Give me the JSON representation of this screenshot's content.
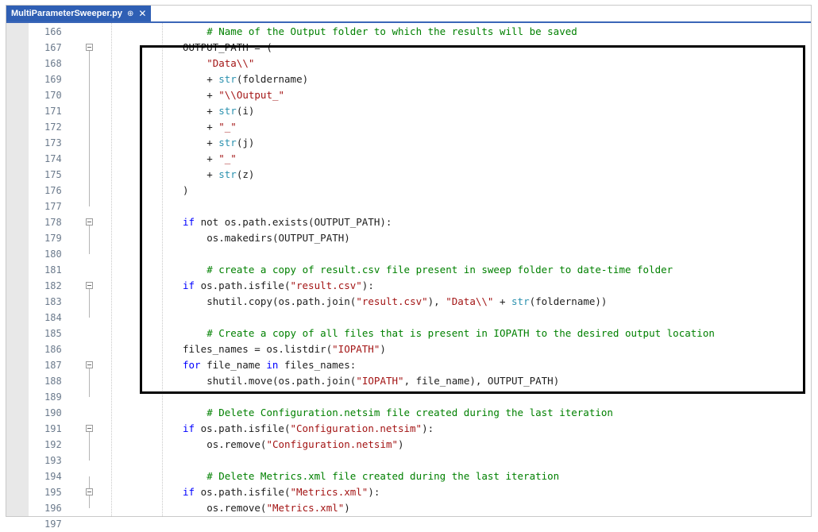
{
  "tab": {
    "title": "MultiParameterSweeper.py",
    "pin_glyph": "⊕",
    "close_glyph": "✕"
  },
  "colors": {
    "keyword": "#0000ff",
    "string": "#a31515",
    "comment": "#008000",
    "builtin": "#2b91af",
    "tab": "#2f5fb4"
  },
  "lines": [
    {
      "n": "166",
      "indent": 8,
      "fold": false,
      "parts": [
        [
          "cm",
          "# Name of the Output folder to which the results will be saved"
        ]
      ]
    },
    {
      "n": "167",
      "indent": 4,
      "fold": true,
      "parts": [
        [
          "t",
          "OUTPUT_PATH = ("
        ]
      ]
    },
    {
      "n": "168",
      "indent": 8,
      "fold": false,
      "parts": [
        [
          "str",
          "\"Data\\\\\""
        ]
      ]
    },
    {
      "n": "169",
      "indent": 8,
      "fold": false,
      "parts": [
        [
          "t",
          "+ "
        ],
        [
          "bi",
          "str"
        ],
        [
          "t",
          "(foldername)"
        ]
      ]
    },
    {
      "n": "170",
      "indent": 8,
      "fold": false,
      "parts": [
        [
          "t",
          "+ "
        ],
        [
          "str",
          "\"\\\\Output_\""
        ]
      ]
    },
    {
      "n": "171",
      "indent": 8,
      "fold": false,
      "parts": [
        [
          "t",
          "+ "
        ],
        [
          "bi",
          "str"
        ],
        [
          "t",
          "(i)"
        ]
      ]
    },
    {
      "n": "172",
      "indent": 8,
      "fold": false,
      "parts": [
        [
          "t",
          "+ "
        ],
        [
          "str",
          "\"_\""
        ]
      ]
    },
    {
      "n": "173",
      "indent": 8,
      "fold": false,
      "parts": [
        [
          "t",
          "+ "
        ],
        [
          "bi",
          "str"
        ],
        [
          "t",
          "(j)"
        ]
      ]
    },
    {
      "n": "174",
      "indent": 8,
      "fold": false,
      "parts": [
        [
          "t",
          "+ "
        ],
        [
          "str",
          "\"_\""
        ]
      ]
    },
    {
      "n": "175",
      "indent": 8,
      "fold": false,
      "parts": [
        [
          "t",
          "+ "
        ],
        [
          "bi",
          "str"
        ],
        [
          "t",
          "(z)"
        ]
      ]
    },
    {
      "n": "176",
      "indent": 4,
      "fold": false,
      "parts": [
        [
          "t",
          ")"
        ]
      ]
    },
    {
      "n": "177",
      "indent": 4,
      "fold": false,
      "parts": []
    },
    {
      "n": "178",
      "indent": 4,
      "fold": true,
      "parts": [
        [
          "kw",
          "if"
        ],
        [
          "t",
          " not os.path.exists(OUTPUT_PATH):"
        ]
      ]
    },
    {
      "n": "179",
      "indent": 8,
      "fold": false,
      "parts": [
        [
          "t",
          "os.makedirs(OUTPUT_PATH)"
        ]
      ]
    },
    {
      "n": "180",
      "indent": 4,
      "fold": false,
      "parts": []
    },
    {
      "n": "181",
      "indent": 8,
      "fold": false,
      "parts": [
        [
          "cm",
          "# create a copy of result.csv file present in sweep folder to date-time folder"
        ]
      ]
    },
    {
      "n": "182",
      "indent": 4,
      "fold": true,
      "parts": [
        [
          "kw",
          "if"
        ],
        [
          "t",
          " os.path.isfile("
        ],
        [
          "str",
          "\"result.csv\""
        ],
        [
          "t",
          "):"
        ]
      ]
    },
    {
      "n": "183",
      "indent": 8,
      "fold": false,
      "parts": [
        [
          "t",
          "shutil.copy(os.path.join("
        ],
        [
          "str",
          "\"result.csv\""
        ],
        [
          "t",
          "), "
        ],
        [
          "str",
          "\"Data\\\\\""
        ],
        [
          "t",
          " + "
        ],
        [
          "bi",
          "str"
        ],
        [
          "t",
          "(foldername))"
        ]
      ]
    },
    {
      "n": "184",
      "indent": 4,
      "fold": false,
      "parts": []
    },
    {
      "n": "185",
      "indent": 8,
      "fold": false,
      "parts": [
        [
          "cm",
          "# Create a copy of all files that is present in IOPATH to the desired output location"
        ]
      ]
    },
    {
      "n": "186",
      "indent": 4,
      "fold": false,
      "parts": [
        [
          "t",
          "files_names = os.listdir("
        ],
        [
          "str",
          "\"IOPATH\""
        ],
        [
          "t",
          ")"
        ]
      ]
    },
    {
      "n": "187",
      "indent": 4,
      "fold": true,
      "parts": [
        [
          "kw",
          "for"
        ],
        [
          "t",
          " file_name "
        ],
        [
          "kw",
          "in"
        ],
        [
          "t",
          " files_names:"
        ]
      ]
    },
    {
      "n": "188",
      "indent": 8,
      "fold": false,
      "parts": [
        [
          "t",
          "shutil.move(os.path.join("
        ],
        [
          "str",
          "\"IOPATH\""
        ],
        [
          "t",
          ", file_name), OUTPUT_PATH)"
        ]
      ]
    },
    {
      "n": "189",
      "indent": 4,
      "fold": false,
      "parts": []
    },
    {
      "n": "190",
      "indent": 8,
      "fold": false,
      "parts": [
        [
          "cm",
          "# Delete Configuration.netsim file created during the last iteration"
        ]
      ]
    },
    {
      "n": "191",
      "indent": 4,
      "fold": true,
      "parts": [
        [
          "kw",
          "if"
        ],
        [
          "t",
          " os.path.isfile("
        ],
        [
          "str",
          "\"Configuration.netsim\""
        ],
        [
          "t",
          "):"
        ]
      ]
    },
    {
      "n": "192",
      "indent": 8,
      "fold": false,
      "parts": [
        [
          "t",
          "os.remove("
        ],
        [
          "str",
          "\"Configuration.netsim\""
        ],
        [
          "t",
          ")"
        ]
      ]
    },
    {
      "n": "193",
      "indent": 4,
      "fold": false,
      "parts": []
    },
    {
      "n": "194",
      "indent": 8,
      "fold": false,
      "parts": [
        [
          "cm",
          "# Delete Metrics.xml file created during the last iteration"
        ]
      ]
    },
    {
      "n": "195",
      "indent": 4,
      "fold": true,
      "parts": [
        [
          "kw",
          "if"
        ],
        [
          "t",
          " os.path.isfile("
        ],
        [
          "str",
          "\"Metrics.xml\""
        ],
        [
          "t",
          "):"
        ]
      ]
    },
    {
      "n": "196",
      "indent": 8,
      "fold": false,
      "parts": [
        [
          "t",
          "os.remove("
        ],
        [
          "str",
          "\"Metrics.xml\""
        ],
        [
          "t",
          ")"
        ]
      ]
    },
    {
      "n": "197",
      "indent": 4,
      "fold": false,
      "parts": []
    }
  ]
}
